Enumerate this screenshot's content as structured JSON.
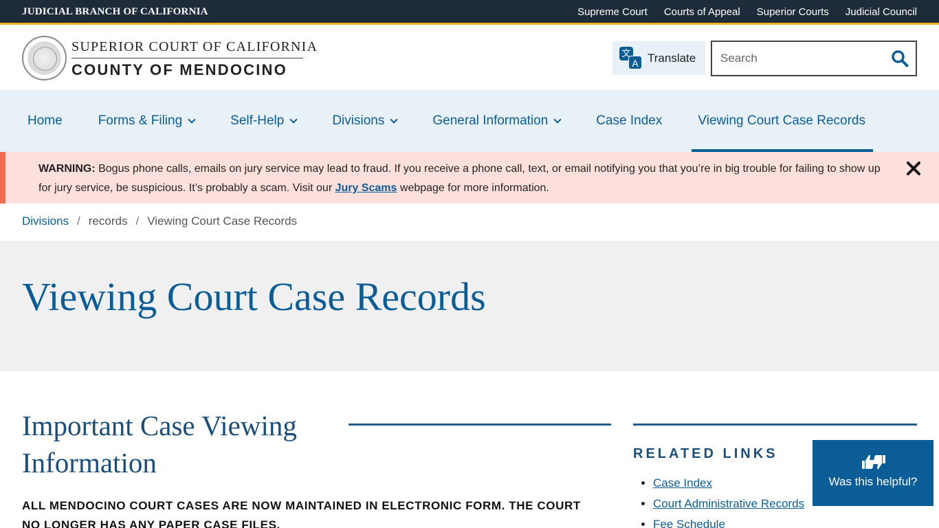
{
  "topbar": {
    "brand": "JUDICIAL BRANCH OF CALIFORNIA",
    "links": [
      "Supreme Court",
      "Courts of Appeal",
      "Superior Courts",
      "Judicial Council"
    ]
  },
  "header": {
    "line1": "SUPERIOR COURT OF CALIFORNIA",
    "line2": "COUNTY OF MENDOCINO",
    "translate_label": "Translate",
    "translate_glyph_a": "文",
    "translate_glyph_b": "A",
    "search_placeholder": "Search"
  },
  "nav": {
    "items": [
      {
        "label": "Home"
      },
      {
        "label": "Forms & Filing"
      },
      {
        "label": "Self-Help"
      },
      {
        "label": "Divisions"
      },
      {
        "label": "General Information"
      },
      {
        "label": "Case Index"
      },
      {
        "label": "Viewing Court Case Records"
      }
    ]
  },
  "warning": {
    "prefix": "WARNING:",
    "text1": " Bogus phone calls, emails on jury service may lead to fraud.  If you receive a phone call, text, or email notifying you that you’re in big trouble for failing to show up for jury service, be suspicious.  It’s probably a scam.  Visit our ",
    "link": "Jury Scams",
    "text2": " webpage for more information."
  },
  "breadcrumb": {
    "items": [
      "Divisions",
      "records",
      "Viewing Court Case Records"
    ],
    "separator": "/"
  },
  "page": {
    "title": "Viewing Court Case Records",
    "section_heading": "Important Case Viewing Information",
    "notice": "ALL MENDOCINO COURT CASES ARE NOW MAINTAINED IN ELECTRONIC FORM.  THE COURT NO LONGER HAS ANY PAPER CASE FILES."
  },
  "related": {
    "heading": "RELATED LINKS",
    "links": [
      "Case Index",
      "Court Administrative Records",
      "Fee Schedule"
    ]
  },
  "helpful": {
    "label": "Was this helpful?"
  },
  "colors": {
    "primary": "#0b5d97",
    "topbar": "#1e2b3a",
    "accent": "#f2b01e",
    "warning_bg": "#fde0dc",
    "warning_border": "#f26c4f"
  }
}
